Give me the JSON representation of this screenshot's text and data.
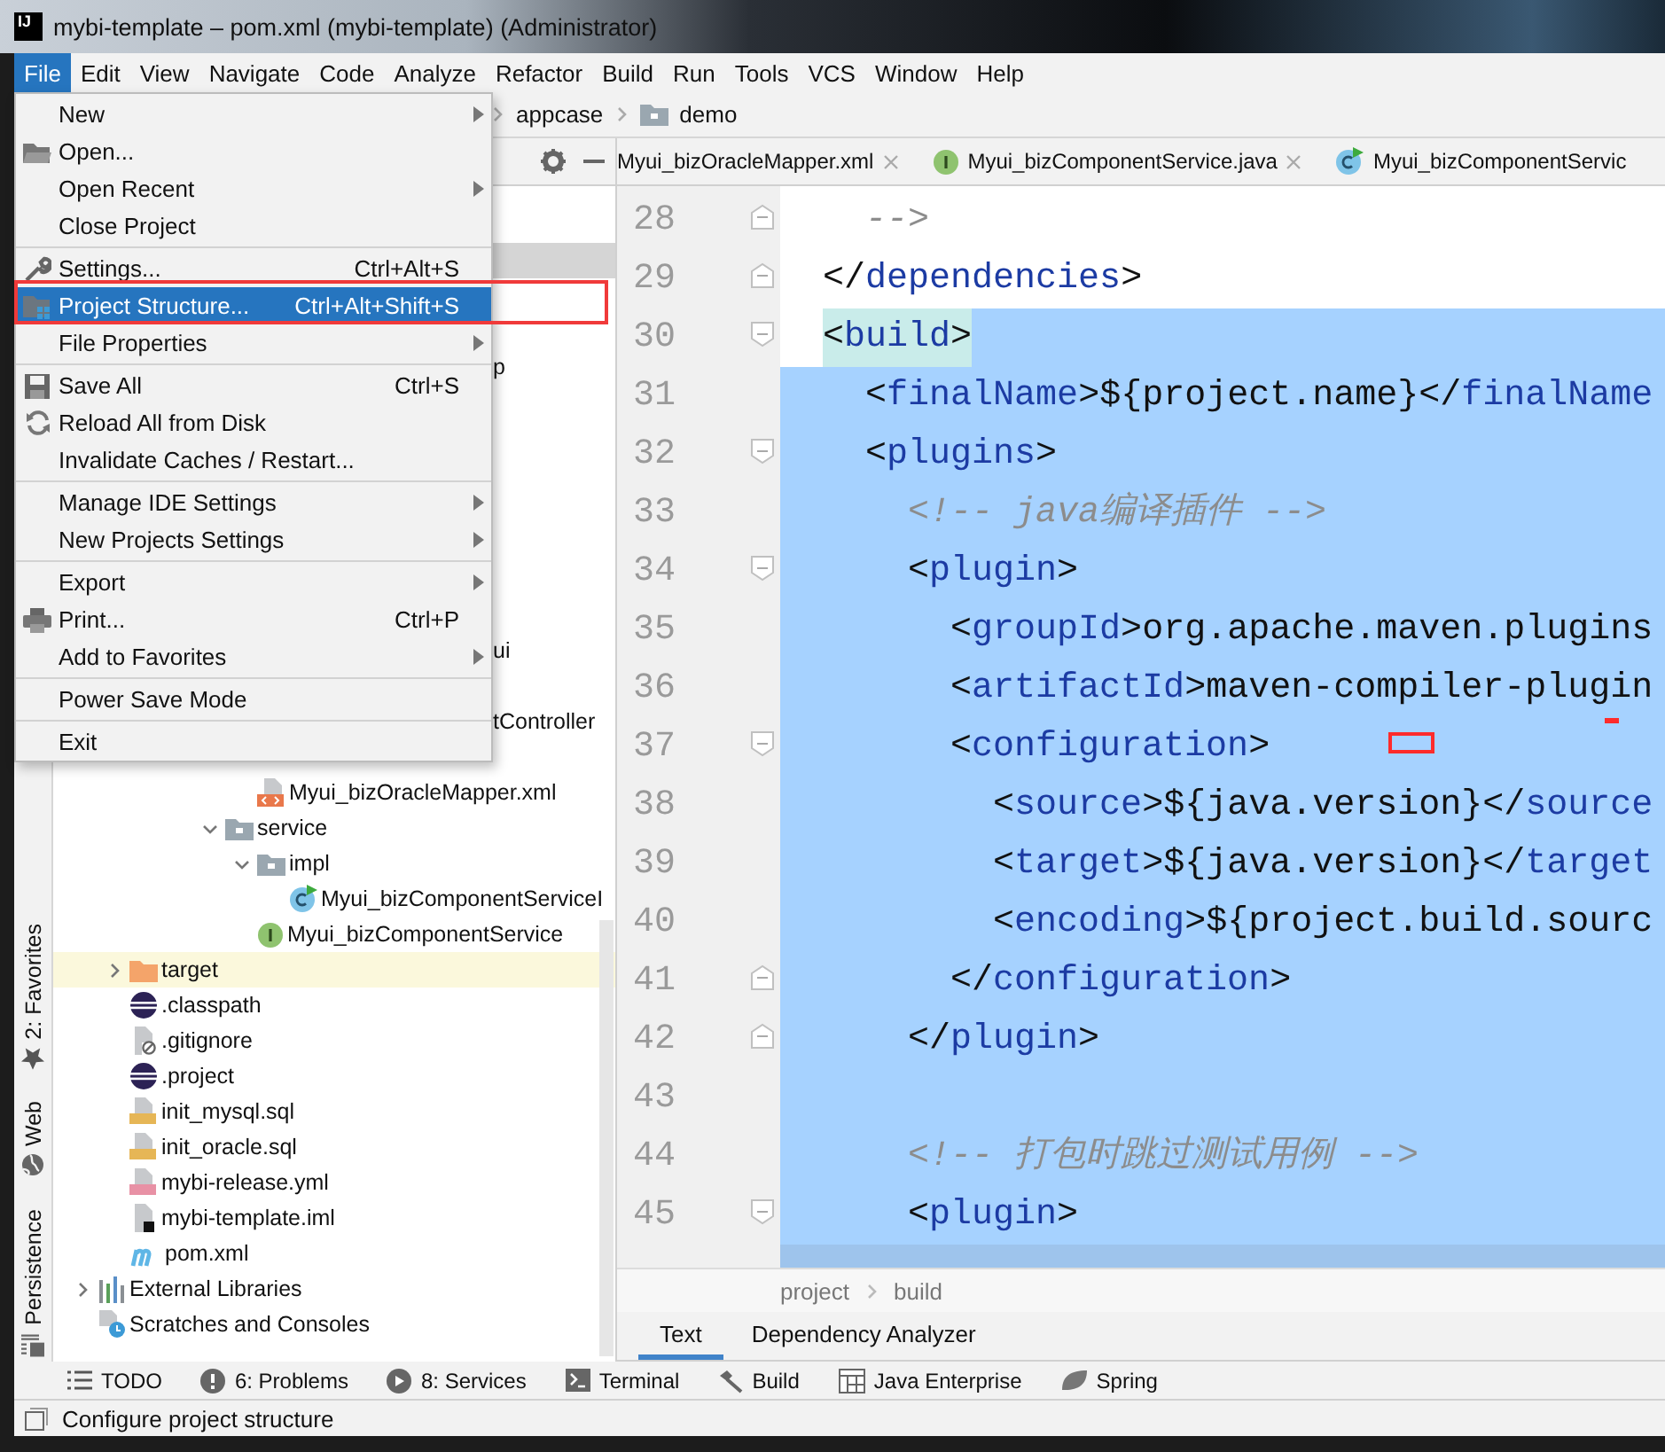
{
  "title_bar": {
    "logo": "IJ",
    "title": "mybi-template – pom.xml (mybi-template) (Administrator)"
  },
  "menu_bar": [
    {
      "label": "File",
      "selected": true
    },
    {
      "label": "Edit",
      "selected": false
    },
    {
      "label": "View",
      "selected": false
    },
    {
      "label": "Navigate",
      "selected": false
    },
    {
      "label": "Code",
      "selected": false
    },
    {
      "label": "Analyze",
      "selected": false
    },
    {
      "label": "Refactor",
      "selected": false
    },
    {
      "label": "Build",
      "selected": false
    },
    {
      "label": "Run",
      "selected": false
    },
    {
      "label": "Tools",
      "selected": false
    },
    {
      "label": "VCS",
      "selected": false
    },
    {
      "label": "Window",
      "selected": false
    },
    {
      "label": "Help",
      "selected": false
    }
  ],
  "file_menu": {
    "groups": [
      [
        {
          "label": "New",
          "submenu": true,
          "selected": false
        },
        {
          "label": "Open...",
          "selected": false
        },
        {
          "label": "Open Recent",
          "submenu": true,
          "selected": false
        },
        {
          "label": "Close Project",
          "selected": false
        }
      ],
      [
        {
          "label": "Settings...",
          "shortcut": "Ctrl+Alt+S",
          "selected": false
        },
        {
          "label": "Project Structure...",
          "shortcut": "Ctrl+Alt+Shift+S",
          "selected": true,
          "annotated": true
        },
        {
          "label": "File Properties",
          "submenu": true,
          "selected": false
        }
      ],
      [
        {
          "label": "Save All",
          "shortcut": "Ctrl+S",
          "selected": false
        },
        {
          "label": "Reload All from Disk",
          "selected": false
        },
        {
          "label": "Invalidate Caches / Restart...",
          "selected": false
        }
      ],
      [
        {
          "label": "Manage IDE Settings",
          "submenu": true,
          "selected": false
        },
        {
          "label": "New Projects Settings",
          "submenu": true,
          "selected": false
        }
      ],
      [
        {
          "label": "Export",
          "submenu": true,
          "selected": false
        },
        {
          "label": "Print...",
          "shortcut": "Ctrl+P",
          "selected": false
        },
        {
          "label": "Add to Favorites",
          "submenu": true,
          "selected": false
        }
      ],
      [
        {
          "label": "Power Save Mode",
          "selected": false
        }
      ],
      [
        {
          "label": "Exit",
          "selected": false
        }
      ]
    ]
  },
  "nav_bar": [
    {
      "text": "appcase",
      "kind": "plain"
    },
    {
      "text": "demo",
      "kind": "folder"
    }
  ],
  "left_tool_tabs": [
    {
      "label": "2: Favorites"
    },
    {
      "label": "Web"
    },
    {
      "label": "Persistence"
    }
  ],
  "project_tree": {
    "covered_row_selected": true,
    "fragments": [
      "p",
      "ui",
      "tController"
    ],
    "items": [
      {
        "children": [
          {
            "children": [
              {
                "children": [
                  {
                    "children": [
                      {
                        "children": [
                          {
                            "text": "Myui_bizOracleMapper.xml",
                            "kind": "xml"
                          }
                        ]
                      },
                      {
                        "text": "service",
                        "kind": "folder",
                        "expanded": true,
                        "children": [
                          {
                            "text": "impl",
                            "kind": "folder",
                            "expanded": true,
                            "children": [
                              {
                                "text": "Myui_bizComponentServiceI",
                                "kind": "class"
                              }
                            ]
                          },
                          {
                            "text": "Myui_bizComponentService",
                            "kind": "interface"
                          }
                        ]
                      }
                    ]
                  }
                ]
              }
            ]
          },
          {
            "text": "target",
            "kind": "folder",
            "expanded": false,
            "excluded": true
          },
          {
            "text": ".classpath",
            "kind": "eclipse"
          },
          {
            "text": ".gitignore",
            "kind": "ignore"
          },
          {
            "text": ".project",
            "kind": "eclipse"
          },
          {
            "text": "init_mysql.sql",
            "kind": "sql"
          },
          {
            "text": "init_oracle.sql",
            "kind": "sql"
          },
          {
            "text": "mybi-release.yml",
            "kind": "yaml"
          },
          {
            "text": "mybi-template.iml",
            "kind": "module"
          },
          {
            "text": "pom.xml",
            "kind": "maven"
          }
        ]
      },
      {
        "text": "External Libraries",
        "kind": "libraries",
        "expanded": false
      },
      {
        "text": "Scratches and Consoles",
        "kind": "scratches"
      }
    ]
  },
  "editor": {
    "tabs": [
      {
        "label": "Myui_bizOracleMapper.xml",
        "closable": true,
        "selected": false
      },
      {
        "label": "Myui_bizComponentService.java",
        "kind": "interface",
        "closable": true,
        "selected": false
      },
      {
        "label": "Myui_bizComponentServic",
        "kind": "class",
        "closable": false,
        "selected": false
      }
    ],
    "lines": [
      {
        "number": "28",
        "kind": "comment",
        "text": "    -->",
        "fold_end": true,
        "selected": false
      },
      {
        "number": "29",
        "kind": "markup",
        "text": "  </dependencies>",
        "fold_end": true,
        "selected": false
      },
      {
        "number": "30",
        "kind": "markup",
        "text": "  <build>",
        "fold_start": true,
        "selected": true,
        "selection_from_text": true,
        "tag_match": true
      },
      {
        "number": "31",
        "kind": "markup",
        "text": "    <finalName>${project.name}</finalName",
        "selected": true
      },
      {
        "number": "32",
        "kind": "markup",
        "text": "    <plugins>",
        "fold_start": true,
        "selected": true
      },
      {
        "number": "33",
        "kind": "comment",
        "text": "      <!-- java编译插件 -->",
        "selected": true
      },
      {
        "number": "34",
        "kind": "markup",
        "text": "      <plugin>",
        "fold_start": true,
        "selected": true
      },
      {
        "number": "35",
        "kind": "markup",
        "text": "        <groupId>org.apache.maven.plugins",
        "selected": true
      },
      {
        "number": "36",
        "kind": "markup",
        "text": "        <artifactId>maven-compiler-plugin",
        "selected": true
      },
      {
        "number": "37",
        "kind": "markup",
        "text": "        <configuration>",
        "fold_start": true,
        "selected": true
      },
      {
        "number": "38",
        "kind": "markup",
        "text": "          <source>${java.version}</source",
        "selected": true
      },
      {
        "number": "39",
        "kind": "markup",
        "text": "          <target>${java.version}</target",
        "selected": true
      },
      {
        "number": "40",
        "kind": "markup",
        "text": "          <encoding>${project.build.sourc",
        "selected": true
      },
      {
        "number": "41",
        "kind": "markup",
        "text": "        </configuration>",
        "fold_end": true,
        "selected": true
      },
      {
        "number": "42",
        "kind": "markup",
        "text": "      </plugin>",
        "fold_end": true,
        "selected": true
      },
      {
        "number": "43",
        "selected": true
      },
      {
        "number": "44",
        "kind": "comment",
        "text": "      <!-- 打包时跳过测试用例 -->",
        "selected": true
      },
      {
        "number": "45",
        "kind": "markup",
        "text": "      <plugin>",
        "fold_start": true,
        "selected": true
      }
    ],
    "marks": [
      {
        "kind": "outline"
      },
      {
        "kind": "dash"
      }
    ],
    "breadcrumb": [
      "project",
      "build"
    ],
    "view_tabs": [
      {
        "label": "Text",
        "selected": true
      },
      {
        "label": "Dependency Analyzer",
        "selected": false
      }
    ]
  },
  "bottom_tool_bar": [
    {
      "label": "TODO"
    },
    {
      "label": "6: Problems"
    },
    {
      "label": "8: Services"
    },
    {
      "label": "Terminal"
    },
    {
      "label": "Build"
    },
    {
      "label": "Java Enterprise"
    },
    {
      "label": "Spring"
    }
  ],
  "status_bar": {
    "text": "Configure project structure"
  }
}
